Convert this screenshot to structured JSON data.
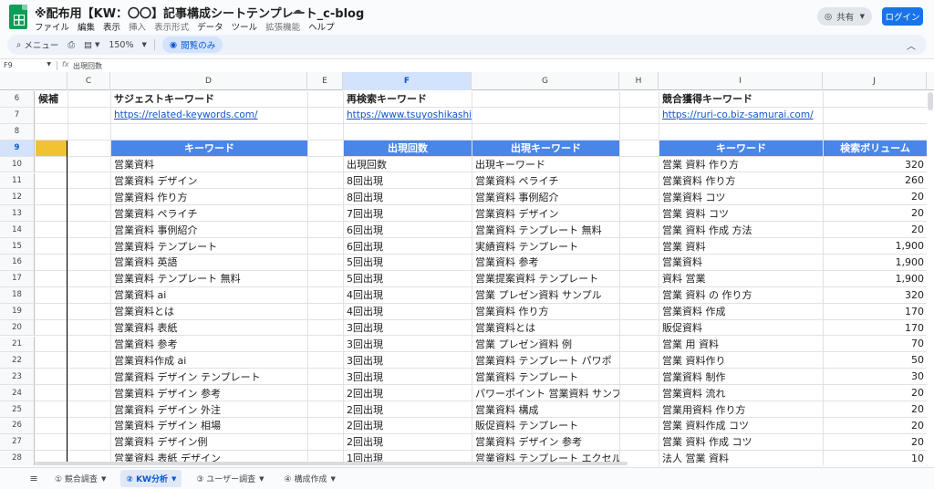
{
  "title": "※配布用【KW：〇〇】記事構成シートテンプレート_c-blog",
  "menu": [
    {
      "label": "ファイル",
      "enabled": true
    },
    {
      "label": "編集",
      "enabled": true
    },
    {
      "label": "表示",
      "enabled": true
    },
    {
      "label": "挿入",
      "enabled": false
    },
    {
      "label": "表示形式",
      "enabled": false
    },
    {
      "label": "データ",
      "enabled": true
    },
    {
      "label": "ツール",
      "enabled": true
    },
    {
      "label": "拡張機能",
      "enabled": false
    },
    {
      "label": "ヘルプ",
      "enabled": true
    }
  ],
  "header": {
    "share_label": "共有",
    "login_label": "ログイン"
  },
  "toolbar": {
    "menu_label": "メニュー",
    "zoom": "150%",
    "view_only_label": "閲覧のみ"
  },
  "formula": {
    "cell_ref": "F9",
    "fx": "fx",
    "value": "出現回数"
  },
  "columns": [
    "",
    "C",
    "D",
    "E",
    "F",
    "G",
    "H",
    "I",
    "J"
  ],
  "rows": {
    "r6": {
      "num": "6",
      "B": "候補",
      "D": "サジェストキーワード",
      "F": "再検索キーワード",
      "I": "競合獲得キーワード"
    },
    "r7": {
      "num": "7",
      "D": "https://related-keywords.com/",
      "F": "https://www.tsuyoshikashiwazaki.com/kw/",
      "I": "https://ruri-co.biz-samurai.com/"
    },
    "r8": {
      "num": "8"
    },
    "r9": {
      "num": "9",
      "D": "キーワード",
      "F": "出現回数",
      "G": "出現キーワード",
      "I": "キーワード",
      "J": "検索ボリューム"
    }
  },
  "data_rows": [
    {
      "num": "10",
      "D": "営業資料",
      "F": "出現回数",
      "G": "出現キーワード",
      "I": "営業 資料 作り方",
      "J": "320"
    },
    {
      "num": "11",
      "D": "営業資料 デザイン",
      "F": "8回出現",
      "G": "営業資料 ペライチ",
      "I": "営業資料 作り方",
      "J": "260"
    },
    {
      "num": "12",
      "D": "営業資料 作り方",
      "F": "8回出現",
      "G": "営業資料 事例紹介",
      "I": "営業資料 コツ",
      "J": "20"
    },
    {
      "num": "13",
      "D": "営業資料 ペライチ",
      "F": "7回出現",
      "G": "営業資料 デザイン",
      "I": "営業 資料 コツ",
      "J": "20"
    },
    {
      "num": "14",
      "D": "営業資料 事例紹介",
      "F": "6回出現",
      "G": "営業資料 テンプレート 無料",
      "I": "営業 資料 作成 方法",
      "J": "20"
    },
    {
      "num": "15",
      "D": "営業資料 テンプレート",
      "F": "6回出現",
      "G": "実績資料 テンプレート",
      "I": "営業 資料",
      "J": "1,900"
    },
    {
      "num": "16",
      "D": "営業資料 英語",
      "F": "5回出現",
      "G": "営業資料 参考",
      "I": "営業資料",
      "J": "1,900"
    },
    {
      "num": "17",
      "D": "営業資料 テンプレート 無料",
      "F": "5回出現",
      "G": "営業提案資料 テンプレート",
      "I": "資料 営業",
      "J": "1,900"
    },
    {
      "num": "18",
      "D": "営業資料 ai",
      "F": "4回出現",
      "G": "営業 プレゼン資料 サンプル",
      "I": "営業 資料 の 作り方",
      "J": "320"
    },
    {
      "num": "19",
      "D": "営業資料とは",
      "F": "4回出現",
      "G": "営業資料 作り方",
      "I": "営業資料 作成",
      "J": "170"
    },
    {
      "num": "20",
      "D": "営業資料 表紙",
      "F": "3回出現",
      "G": "営業資料とは",
      "I": "販促資料",
      "J": "170"
    },
    {
      "num": "21",
      "D": "営業資料 参考",
      "F": "3回出現",
      "G": "営業 プレゼン資料 例",
      "I": "営業 用 資料",
      "J": "70"
    },
    {
      "num": "22",
      "D": "営業資料作成 ai",
      "F": "3回出現",
      "G": "営業資料 テンプレート パワポ",
      "I": "営業 資料作り",
      "J": "50"
    },
    {
      "num": "23",
      "D": "営業資料 デザイン テンプレート",
      "F": "3回出現",
      "G": "営業資料 テンプレート",
      "I": "営業資料 制作",
      "J": "30"
    },
    {
      "num": "24",
      "D": "営業資料 デザイン 参考",
      "F": "2回出現",
      "G": "パワーポイント 営業資料 サンプル",
      "I": "営業資料 流れ",
      "J": "20"
    },
    {
      "num": "25",
      "D": "営業資料 デザイン 外注",
      "F": "2回出現",
      "G": "営業資料 構成",
      "I": "営業用資料 作り方",
      "J": "20"
    },
    {
      "num": "26",
      "D": "営業資料 デザイン 相場",
      "F": "2回出現",
      "G": "販促資料 テンプレート",
      "I": "営業 資料作成 コツ",
      "J": "20"
    },
    {
      "num": "27",
      "D": "営業資料 デザイン例",
      "F": "2回出現",
      "G": "営業資料 デザイン 参考",
      "I": "営業 資料 作成 コツ",
      "J": "20"
    },
    {
      "num": "28",
      "D": "営業資料 表紙 デザイン",
      "F": "1回出現",
      "G": "営業資料 テンプレート エクセル",
      "I": "法人 営業 資料",
      "J": "10"
    }
  ],
  "sheet_tabs": [
    {
      "label": "① 競合調査",
      "active": false
    },
    {
      "label": "② KW分析",
      "active": true
    },
    {
      "label": "③ ユーザー調査",
      "active": false
    },
    {
      "label": "④ 構成作成",
      "active": false
    }
  ],
  "icons": {
    "cloud": "cloud-status-icon",
    "globe": "globe-icon",
    "search": "search-icon",
    "print": "print-icon",
    "paint": "paint-format-icon",
    "eye": "eye-icon",
    "collapse": "chevron-up-icon",
    "sheets": "all-sheets-icon"
  }
}
